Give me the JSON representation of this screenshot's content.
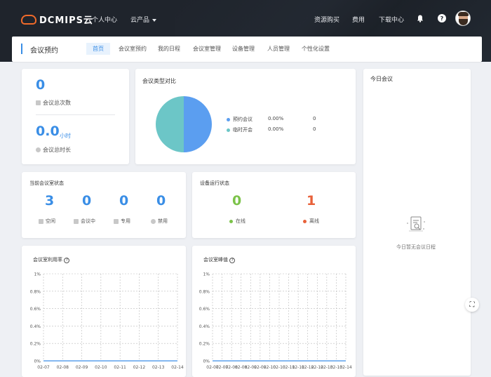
{
  "brand": {
    "logo_text": "DCMIPS云"
  },
  "topnav": {
    "personal_center": "个人中心",
    "cloud_products": "云产品",
    "resource_purchase": "资源购买",
    "fees": "费用",
    "download_center": "下载中心"
  },
  "subnav": {
    "title": "会议预约",
    "tabs": [
      "首页",
      "会议室预约",
      "我的日程",
      "会议室管理",
      "设备管理",
      "人员管理",
      "个性化设置"
    ],
    "active_tab": "首页"
  },
  "stats": {
    "total_count": "0",
    "total_count_label": "会议总次数",
    "total_hours": "0.0",
    "total_hours_unit": "小时",
    "total_hours_label": "会议总时长"
  },
  "type_compare": {
    "title": "会议类型对比",
    "legend": [
      {
        "name": "预约会议",
        "percent": "0.00%",
        "count": "0",
        "color": "#5b9ef0"
      },
      {
        "name": "临时开会",
        "percent": "0.00%",
        "count": "0",
        "color": "#6cc6c7"
      }
    ],
    "chart_data": {
      "type": "pie",
      "slices": [
        {
          "name": "预约会议",
          "value": 50,
          "color": "#5b9ef0"
        },
        {
          "name": "临时开会",
          "value": 50,
          "color": "#6cc6c7"
        }
      ]
    }
  },
  "today": {
    "title": "今日会议",
    "empty_text": "今日暂无会议日程"
  },
  "room_status": {
    "title": "当前会议室状态",
    "items": [
      {
        "value": "3",
        "label": "空闲"
      },
      {
        "value": "0",
        "label": "会议中"
      },
      {
        "value": "0",
        "label": "专用"
      },
      {
        "value": "0",
        "label": "禁用"
      }
    ]
  },
  "device_status": {
    "title": "设备运行状态",
    "online": {
      "value": "0",
      "label": "在线",
      "color": "#7cc34a"
    },
    "offline": {
      "value": "1",
      "label": "离线",
      "color": "#e8613a"
    }
  },
  "utilization": {
    "title": "会议室利用率",
    "chart_data": {
      "type": "line",
      "categories": [
        "02-07",
        "02-08",
        "02-09",
        "02-10",
        "02-11",
        "02-12",
        "02-13",
        "02-14"
      ],
      "series": [
        {
          "values": [
            0,
            0,
            0,
            0,
            0,
            0,
            0,
            0
          ]
        }
      ],
      "yticks": [
        "0%",
        "0.2%",
        "0.4%",
        "0.6%",
        "0.8%",
        "1%"
      ],
      "ylim": [
        0,
        1
      ],
      "grid": true
    }
  },
  "peak": {
    "title": "会议室峰值",
    "chart_data": {
      "type": "line",
      "categories": [
        "02-07",
        "02-07",
        "02-08",
        "02-08",
        "02-09",
        "02-09",
        "02-10",
        "02-10",
        "02-11",
        "02-11",
        "02-12",
        "02-12",
        "02-13",
        "02-13",
        "02-14"
      ],
      "series": [
        {
          "values": [
            0,
            0,
            0,
            0,
            0,
            0,
            0,
            0,
            0,
            0,
            0,
            0,
            0,
            0,
            0
          ]
        }
      ],
      "yticks": [
        "0%",
        "0.2%",
        "0.4%",
        "0.6%",
        "0.8%",
        "1%"
      ],
      "ylim": [
        0,
        1
      ],
      "grid": true
    }
  }
}
